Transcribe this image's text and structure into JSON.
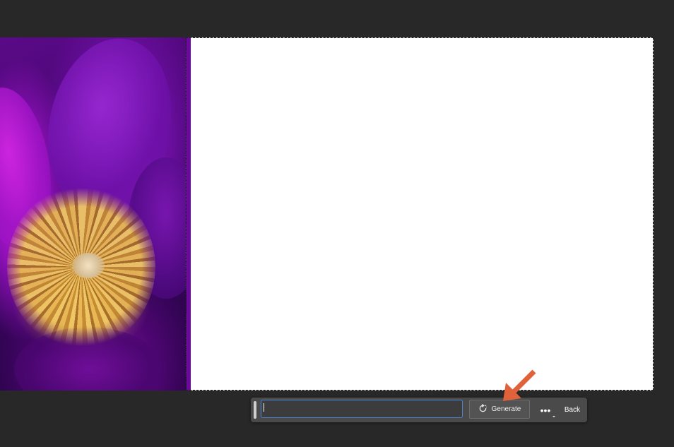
{
  "canvas": {
    "image_description_icon": "flower-photo",
    "expand_fill_color": "#ffffff",
    "background_color": "#282828"
  },
  "taskbar": {
    "prompt": {
      "value": "",
      "placeholder": ""
    },
    "generate_label": "Generate",
    "generate_icon": "generate-refresh-icon",
    "more_label": "•••",
    "more_icon": "more-options-icon",
    "back_label": "Back"
  },
  "colors": {
    "accent_input_border": "#4d87d4",
    "annotation_arrow": "#e0623a",
    "taskbar_bg": "#4a4a4a"
  }
}
